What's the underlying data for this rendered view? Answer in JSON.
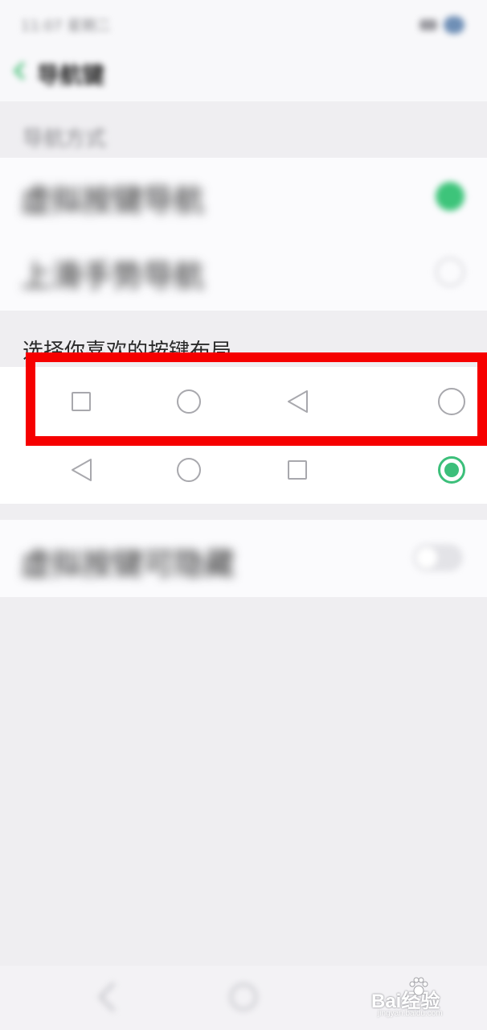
{
  "status_bar": {
    "time": "11:07 星期二",
    "icons": [
      "signal-icon",
      "battery-icon"
    ]
  },
  "header": {
    "back_icon": "back-arrow-icon",
    "title": "导航键"
  },
  "nav_section": {
    "title": "导航方式",
    "options": [
      {
        "label": "虚拟按键导航",
        "selected": true
      },
      {
        "label": "上滑手势导航",
        "selected": false
      }
    ]
  },
  "layout_section": {
    "title": "选择你喜欢的按键布局",
    "layouts": [
      {
        "order": [
          "square-icon",
          "circle-icon",
          "back-triangle-icon"
        ],
        "selected": false
      },
      {
        "order": [
          "back-triangle-icon",
          "circle-icon",
          "square-icon"
        ],
        "selected": true
      }
    ]
  },
  "hide_keys": {
    "label": "虚拟按键可隐藏",
    "enabled": false
  },
  "bottom_nav": {
    "icons": [
      "back-icon",
      "home-icon"
    ]
  },
  "watermark": {
    "text": "Bai经验",
    "subtext": "jingyan.baidu.com"
  },
  "colors": {
    "accent": "#3cbf7a",
    "highlight": "#f60000",
    "background": "#efeef1"
  }
}
